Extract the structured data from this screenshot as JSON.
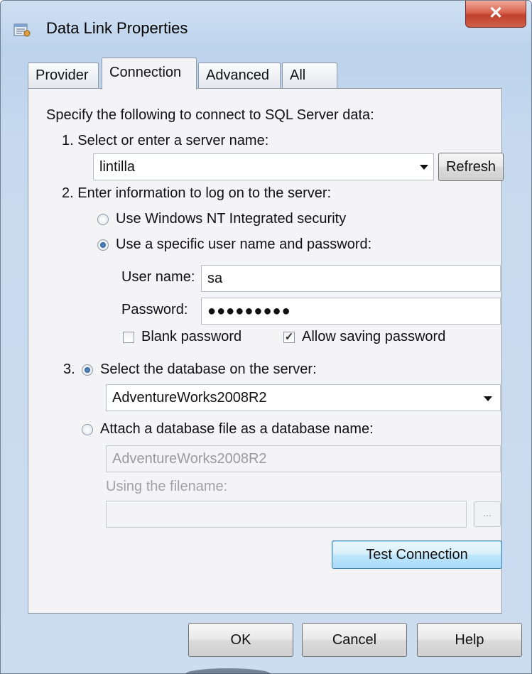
{
  "window": {
    "title": "Data Link Properties",
    "close_glyph": "✕"
  },
  "tabs": [
    {
      "label": "Provider"
    },
    {
      "label": "Connection"
    },
    {
      "label": "Advanced"
    },
    {
      "label": "All"
    }
  ],
  "connection": {
    "intro": "Specify the following to connect to SQL Server data:",
    "step1_label": "1. Select or enter a server name:",
    "server_name": "lintilla",
    "refresh_label": "Refresh",
    "step2_label": "2. Enter information to log on to the server:",
    "radio_windows": "Use Windows NT Integrated security",
    "radio_specific": "Use a specific user name and password:",
    "username_label": "User name:",
    "username_value": "sa",
    "password_label": "Password:",
    "password_value": "●●●●●●●●●",
    "blank_password_label": "Blank password",
    "blank_password_checked": false,
    "allow_saving_label": "Allow saving password",
    "allow_saving_checked": true,
    "step3_number": "3.",
    "radio_select_db": "Select the database on the server:",
    "database_value": "AdventureWorks2008R2",
    "radio_attach": "Attach a database file as a database name:",
    "attach_db_value": "AdventureWorks2008R2",
    "filename_label": "Using the filename:",
    "filename_value": "",
    "browse_label": "...",
    "test_connection_label": "Test Connection"
  },
  "footer": {
    "ok_label": "OK",
    "cancel_label": "Cancel",
    "help_label": "Help"
  },
  "colors": {
    "title_gradient_top": "#cfe0f3",
    "close_button": "#c0402c",
    "focus_button": "#3c7fb1"
  }
}
